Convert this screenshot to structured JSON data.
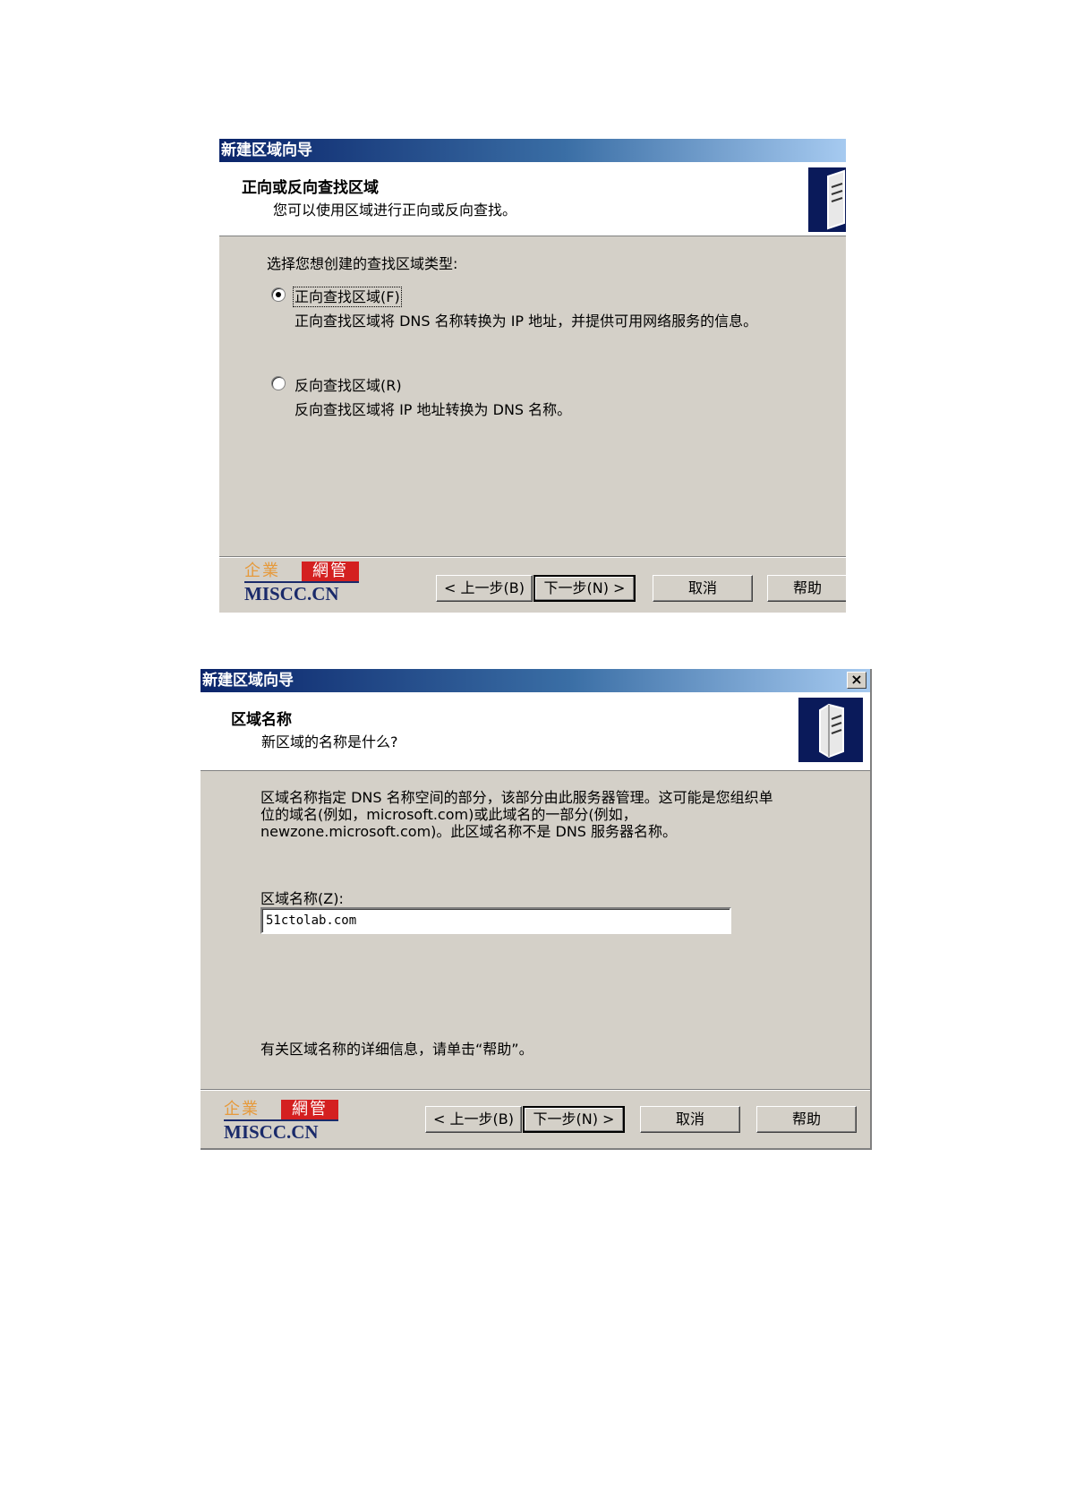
{
  "dialog1": {
    "title": "新建区域向导",
    "header_title": "正向或反向查找区域",
    "header_subtitle": "您可以使用区域进行正向或反向查找。",
    "prompt": "选择您想创建的查找区域类型:",
    "options": [
      {
        "label": "正向查找区域(F)",
        "description": "正向查找区域将 DNS 名称转换为 IP 地址，并提供可用网络服务的信息。",
        "selected": true
      },
      {
        "label": "反向查找区域(R)",
        "description": "反向查找区域将 IP 地址转换为 DNS 名称。",
        "selected": false
      }
    ],
    "buttons": {
      "back": "< 上一步(B)",
      "next": "下一步(N) >",
      "cancel": "取消",
      "help": "帮助"
    },
    "logo": {
      "cn_left": "企業",
      "cn_right": "網管",
      "en": "MISCC.CN"
    }
  },
  "dialog2": {
    "title": "新建区域向导",
    "close": "×",
    "header_title": "区域名称",
    "header_subtitle": "新区域的名称是什么?",
    "description_lines": [
      "区域名称指定 DNS 名称空间的部分，该部分由此服务器管理。这可能是您组织单",
      "位的域名(例如，microsoft.com)或此域名的一部分(例如，",
      "newzone.microsoft.com)。此区域名称不是 DNS 服务器名称。"
    ],
    "field_label": "区域名称(Z):",
    "field_value": "51ctolab.com",
    "help_text": "有关区域名称的详细信息，请单击“帮助”。",
    "buttons": {
      "back": "< 上一步(B)",
      "next": "下一步(N) >",
      "cancel": "取消",
      "help": "帮助"
    },
    "logo": {
      "cn_left": "企業",
      "cn_right": "網管",
      "en": "MISCC.CN"
    }
  },
  "colors": {
    "face": "#d4d0c8",
    "title_start": "#0a246a",
    "title_end": "#a6caf0",
    "logo_red": "#d42020",
    "logo_orange": "#e69a3c",
    "logo_navy": "#1a2a6a"
  },
  "icons": [
    "server-icon",
    "close-icon",
    "radio-selected-icon",
    "radio-unselected-icon"
  ]
}
